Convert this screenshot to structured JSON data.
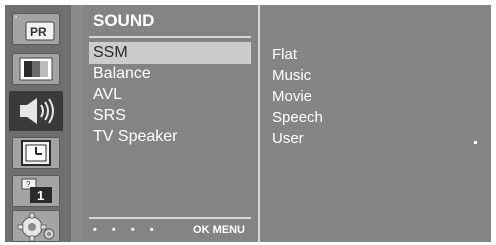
{
  "icons": [
    {
      "name": "picture-mode-icon",
      "label": "PR"
    },
    {
      "name": "picture-icon"
    },
    {
      "name": "sound-icon",
      "active": true
    },
    {
      "name": "time-icon"
    },
    {
      "name": "option-icon",
      "label": "1"
    },
    {
      "name": "setup-icon"
    }
  ],
  "menu": {
    "title": "SOUND",
    "items": [
      {
        "label": "SSM",
        "selected": true
      },
      {
        "label": "Balance"
      },
      {
        "label": "AVL"
      },
      {
        "label": "SRS"
      },
      {
        "label": "TV Speaker"
      }
    ],
    "footer_dots": "• • • •",
    "footer_hint": "OK MENU"
  },
  "options": {
    "items": [
      "Flat",
      "Music",
      "Movie",
      "Speech",
      "User"
    ]
  },
  "colors": {
    "background": "#8a8a8a",
    "icon_column": "#6f6f6f",
    "selected_bar": "#cccccc",
    "text": "#ffffff"
  }
}
